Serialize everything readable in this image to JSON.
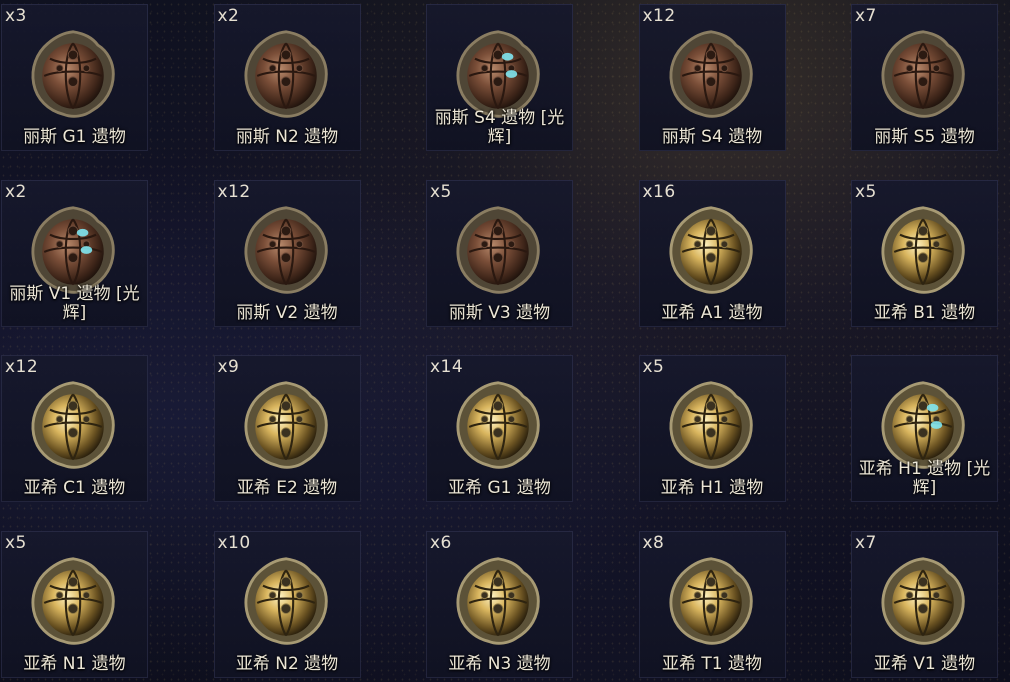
{
  "items": [
    {
      "count": "x3",
      "name": "丽斯 G1 遗物",
      "kind": "bronze",
      "glow": false
    },
    {
      "count": "x2",
      "name": "丽斯 N2 遗物",
      "kind": "bronze",
      "glow": false
    },
    {
      "count": "",
      "name": "丽斯 S4 遗物 [光辉]",
      "kind": "bronze",
      "glow": true
    },
    {
      "count": "x12",
      "name": "丽斯 S4 遗物",
      "kind": "bronze",
      "glow": false
    },
    {
      "count": "x7",
      "name": "丽斯 S5 遗物",
      "kind": "bronze",
      "glow": false
    },
    {
      "count": "x2",
      "name": "丽斯 V1 遗物 [光辉]",
      "kind": "bronze",
      "glow": true
    },
    {
      "count": "x12",
      "name": "丽斯 V2 遗物",
      "kind": "bronze",
      "glow": false
    },
    {
      "count": "x5",
      "name": "丽斯 V3 遗物",
      "kind": "bronze",
      "glow": false
    },
    {
      "count": "x16",
      "name": "亚希 A1 遗物",
      "kind": "gold",
      "glow": false
    },
    {
      "count": "x5",
      "name": "亚希 B1 遗物",
      "kind": "gold",
      "glow": false
    },
    {
      "count": "x12",
      "name": "亚希 C1 遗物",
      "kind": "gold",
      "glow": false
    },
    {
      "count": "x9",
      "name": "亚希 E2 遗物",
      "kind": "gold",
      "glow": false
    },
    {
      "count": "x14",
      "name": "亚希 G1 遗物",
      "kind": "gold",
      "glow": false
    },
    {
      "count": "x5",
      "name": "亚希 H1 遗物",
      "kind": "gold",
      "glow": false
    },
    {
      "count": "",
      "name": "亚希 H1 遗物 [光辉]",
      "kind": "gold",
      "glow": true
    },
    {
      "count": "x5",
      "name": "亚希 N1 遗物",
      "kind": "gold",
      "glow": false
    },
    {
      "count": "x10",
      "name": "亚希 N2 遗物",
      "kind": "gold",
      "glow": false
    },
    {
      "count": "x6",
      "name": "亚希 N3 遗物",
      "kind": "gold",
      "glow": false
    },
    {
      "count": "x8",
      "name": "亚希 T1 遗物",
      "kind": "gold",
      "glow": false
    },
    {
      "count": "x7",
      "name": "亚希 V1 遗物",
      "kind": "gold",
      "glow": false
    }
  ],
  "colors": {
    "bronze": "#7a4e38",
    "gold": "#c9a85a",
    "glow": "#7fe6f0"
  }
}
